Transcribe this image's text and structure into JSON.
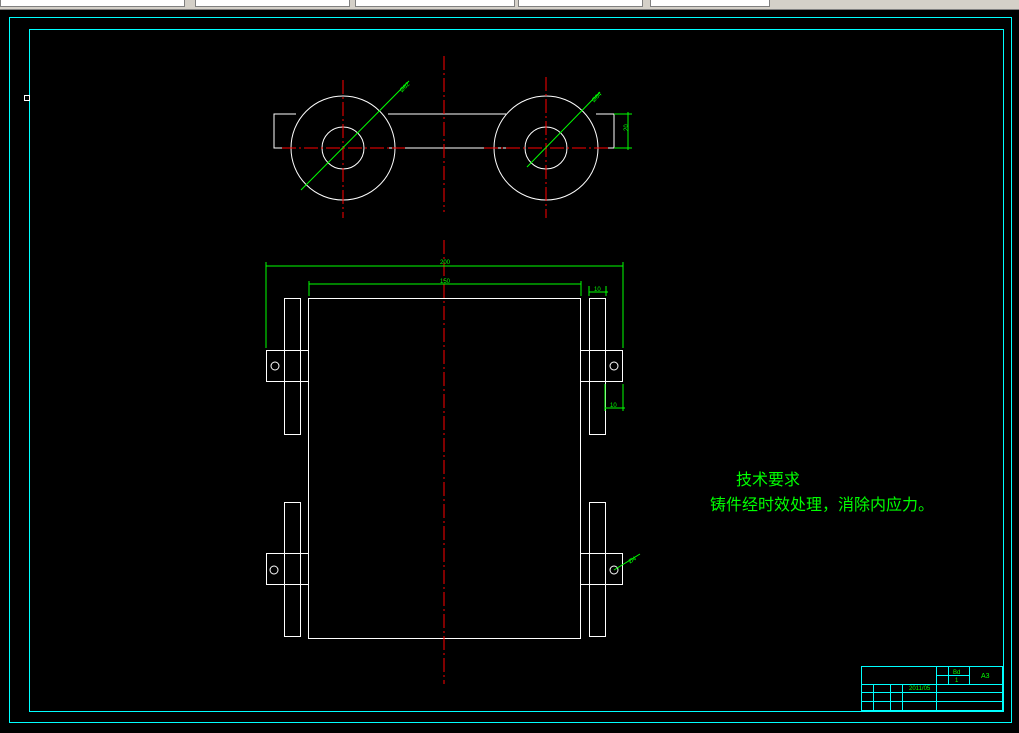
{
  "drawing": {
    "dimensions": {
      "top_view_diameter_large": "Ø62",
      "top_view_diameter_small": "Ø64",
      "top_view_height": "20",
      "overall_width": "200",
      "inner_width": "150",
      "lug_width": "10",
      "lug_offset": "10",
      "hole_diameter": "Ø4"
    },
    "tech_requirements": {
      "title": "技术要求",
      "body": "铸件经时效处理，消除内应力。"
    },
    "title_block": {
      "weight_label": "Bd",
      "weight_value": "1",
      "sheet_size": "A3",
      "date": "2011/05"
    }
  },
  "colors": {
    "background": "#000000",
    "frame": "#00ffff",
    "geometry": "#ffffff",
    "centerline": "#ff0000",
    "dimension": "#00ff00"
  }
}
